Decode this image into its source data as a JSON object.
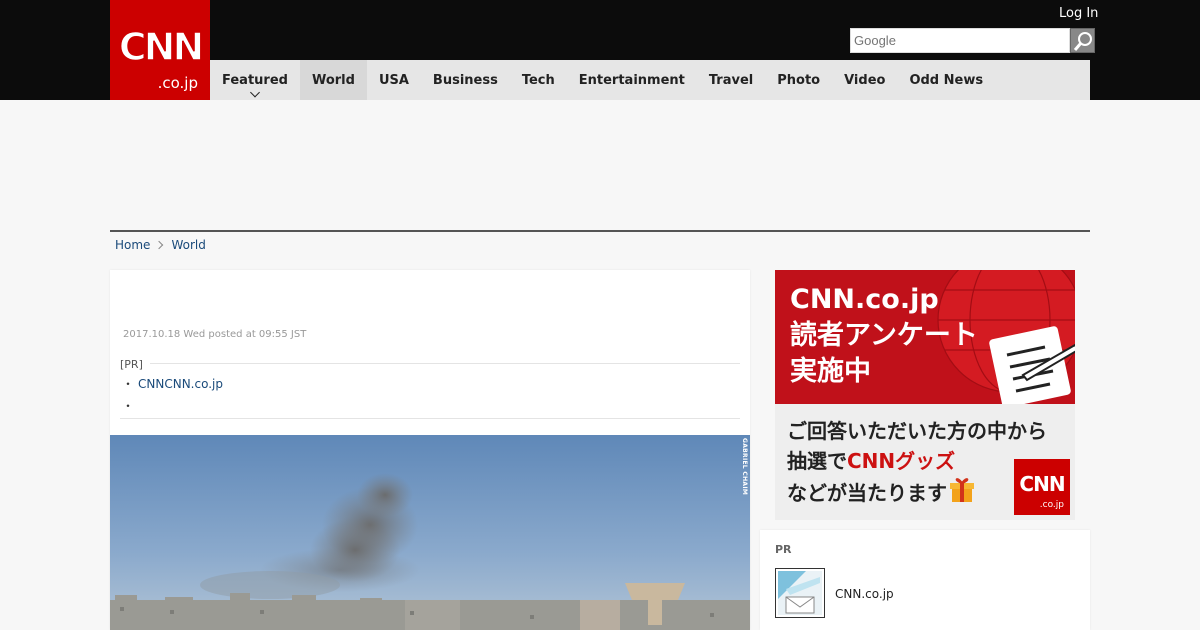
{
  "header": {
    "logo_text": "CNN",
    "logo_sub": ".co.jp",
    "login_label": "Log In",
    "search_placeholder": "Google",
    "colors": {
      "brand_red": "#cc0000",
      "topbar": "#0c0c0c",
      "nav_bg": "#e6e6e6"
    }
  },
  "nav": {
    "items": [
      {
        "label": "Featured"
      },
      {
        "label": "World"
      },
      {
        "label": "USA"
      },
      {
        "label": "Business"
      },
      {
        "label": "Tech"
      },
      {
        "label": "Entertainment"
      },
      {
        "label": "Travel"
      },
      {
        "label": "Photo"
      },
      {
        "label": "Video"
      },
      {
        "label": "Odd News"
      }
    ]
  },
  "breadcrumb": {
    "home": "Home",
    "current": "World"
  },
  "article": {
    "date": "2017.10.18 Wed posted at 09:55 JST",
    "pr_label": "[PR]",
    "pr_bullet": "・",
    "pr_link": "CNNCNN.co.jp",
    "photo_credit": "GABRIEL CHAIM"
  },
  "ad": {
    "title_lines": [
      "CNN.co.jp",
      "読者アンケート",
      "実施中"
    ],
    "body_line1": "ご回答いただいた方の中から",
    "body_line2_pre": "抽選で",
    "body_line2_red": "CNNグッズ",
    "body_line3": "などが当たります"
  },
  "pr_box": {
    "label": "PR",
    "text": "CNN.co.jp"
  }
}
